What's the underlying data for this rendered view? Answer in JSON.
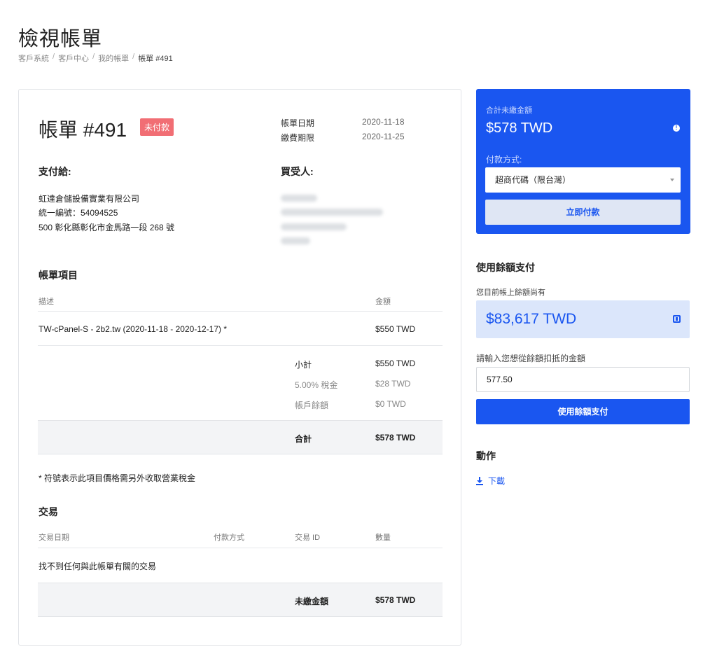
{
  "page": {
    "title": "檢視帳單",
    "breadcrumb": [
      "客戶系統",
      "客戶中心",
      "我的帳單",
      "帳單 #491"
    ]
  },
  "invoice": {
    "title": "帳單 #491",
    "status": "未付款",
    "invoice_date_label": "帳單日期",
    "invoice_date": "2020-11-18",
    "due_date_label": "繳費期限",
    "due_date": "2020-11-25",
    "pay_to_heading": "支付給:",
    "pay_to_lines": [
      "虹達倉儲設備實業有限公司",
      "統一編號：54094525",
      "500 彰化縣彰化市金馬路一段 268 號"
    ],
    "invoiced_to_heading": "買受人:",
    "items_heading": "帳單項目",
    "col_description": "描述",
    "col_amount": "金額",
    "items": [
      {
        "description": "TW-cPanel-S - 2b2.tw (2020-11-18 - 2020-12-17) *",
        "amount": "$550 TWD"
      }
    ],
    "subtotal_label": "小計",
    "subtotal": "$550 TWD",
    "tax_label": "5.00% 稅金",
    "tax": "$28 TWD",
    "credit_label": "帳戶餘額",
    "credit": "$0 TWD",
    "total_label": "合計",
    "total": "$578 TWD",
    "tax_note": "* 符號表示此項目價格需另外收取營業稅金",
    "transactions_heading": "交易",
    "tx_col_date": "交易日期",
    "tx_col_gateway": "付款方式",
    "tx_col_id": "交易 ID",
    "tx_col_amount": "數量",
    "tx_empty": "找不到任何與此帳單有關的交易",
    "balance_label": "未繳金額",
    "balance": "$578 TWD"
  },
  "payment": {
    "due_label": "合計未繳金額",
    "due_amount": "$578 TWD",
    "method_label": "付款方式:",
    "method_selected": "超商代碼（限台灣）",
    "pay_button": "立即付款"
  },
  "credit_pay": {
    "heading": "使用餘額支付",
    "balance_label": "您目前帳上餘額尚有",
    "balance": "$83,617 TWD",
    "input_label": "請輸入您想從餘額扣抵的金額",
    "input_value": "577.50",
    "button": "使用餘額支付"
  },
  "actions": {
    "heading": "動作",
    "download": "下載"
  },
  "colors": {
    "primary": "#1a56f0",
    "unpaid_badge": "#f16e74"
  }
}
